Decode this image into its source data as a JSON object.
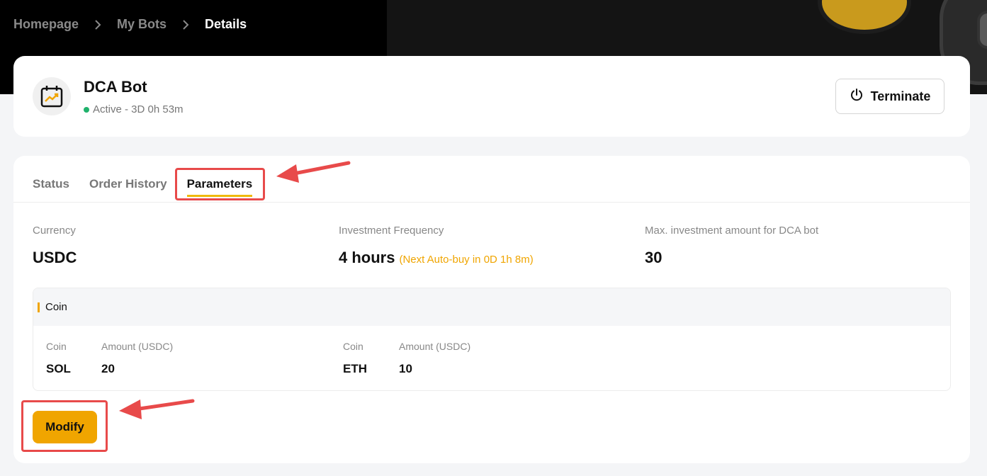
{
  "breadcrumb": {
    "items": [
      "Homepage",
      "My Bots",
      "Details"
    ]
  },
  "bot": {
    "name": "DCA Bot",
    "status": "Active - 3D 0h 53m",
    "terminate_label": "Terminate"
  },
  "tabs": [
    {
      "label": "Status",
      "active": false
    },
    {
      "label": "Order History",
      "active": false
    },
    {
      "label": "Parameters",
      "active": true
    }
  ],
  "parameters": {
    "currency": {
      "label": "Currency",
      "value": "USDC"
    },
    "frequency": {
      "label": "Investment Frequency",
      "value": "4 hours",
      "note": "(Next Auto-buy in 0D 1h 8m)"
    },
    "max_amount": {
      "label": "Max. investment amount for DCA bot",
      "value": "30"
    }
  },
  "coin_section": {
    "title": "Coin",
    "coin_label": "Coin",
    "amount_label": "Amount (USDC)",
    "coins": [
      {
        "coin": "SOL",
        "amount": "20"
      },
      {
        "coin": "ETH",
        "amount": "10"
      }
    ]
  },
  "modify_label": "Modify",
  "colors": {
    "accent": "#f0a500",
    "status_active": "#20b26c",
    "annotation": "#e84a4a"
  }
}
